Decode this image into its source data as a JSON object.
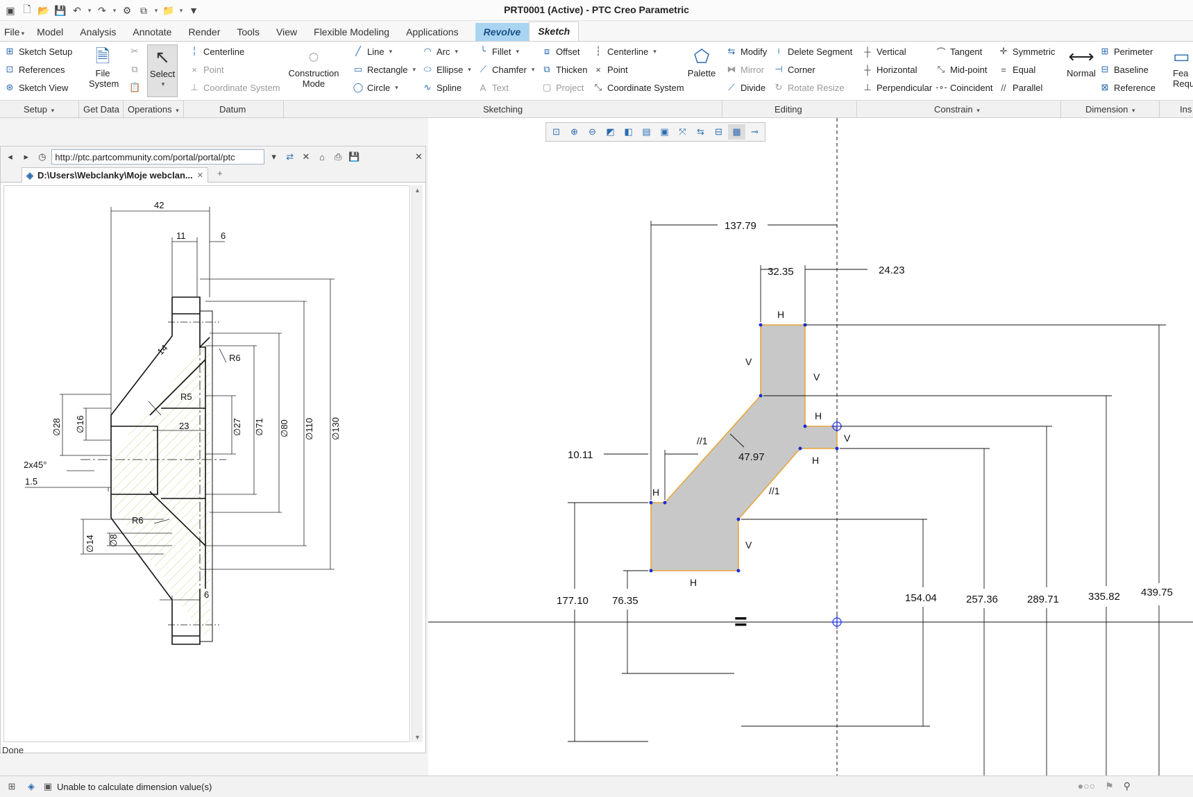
{
  "window": {
    "title": "PRT0001 (Active) - PTC Creo Parametric"
  },
  "quick_access": [
    "new-icon",
    "open-icon",
    "save-icon",
    "undo-icon",
    "redo-icon",
    "regenerate-icon",
    "windows-icon",
    "close-icon",
    "customize-icon"
  ],
  "menu_tabs": {
    "file": "File",
    "model": "Model",
    "analysis": "Analysis",
    "annotate": "Annotate",
    "render": "Render",
    "tools": "Tools",
    "view": "View",
    "flexible": "Flexible Modeling",
    "applications": "Applications",
    "revolve": "Revolve",
    "sketch": "Sketch"
  },
  "ribbon": {
    "setup": {
      "sketch_setup": "Sketch Setup",
      "references": "References",
      "sketch_view": "Sketch View"
    },
    "get_data": {
      "file_system": "File System"
    },
    "operations": {
      "select": "Select"
    },
    "datum": {
      "centerline": "Centerline",
      "point": "Point",
      "coordinate_system": "Coordinate System"
    },
    "construction": {
      "construction_mode": "Construction Mode"
    },
    "sketching": {
      "line": "Line",
      "rectangle": "Rectangle",
      "circle": "Circle",
      "arc": "Arc",
      "ellipse": "Ellipse",
      "spline": "Spline",
      "fillet": "Fillet",
      "chamfer": "Chamfer",
      "text": "Text",
      "offset": "Offset",
      "thicken": "Thicken",
      "project": "Project",
      "centerline": "Centerline",
      "point": "Point",
      "coordinate_system": "Coordinate System",
      "palette": "Palette"
    },
    "editing": {
      "modify": "Modify",
      "delete_segment": "Delete Segment",
      "mirror": "Mirror",
      "corner": "Corner",
      "divide": "Divide",
      "rotate_resize": "Rotate Resize"
    },
    "constrain": {
      "vertical": "Vertical",
      "tangent": "Tangent",
      "symmetric": "Symmetric",
      "horizontal": "Horizontal",
      "midpoint": "Mid-point",
      "equal": "Equal",
      "perpendicular": "Perpendicular",
      "coincident": "Coincident",
      "parallel": "Parallel"
    },
    "dimension": {
      "normal": "Normal",
      "perimeter": "Perimeter",
      "baseline": "Baseline",
      "reference": "Reference"
    },
    "inspect": {
      "feature_requirements": "Fea Requir"
    }
  },
  "groups": {
    "setup": "Setup",
    "get_data": "Get Data",
    "operations": "Operations",
    "datum": "Datum",
    "sketching": "Sketching",
    "editing": "Editing",
    "constrain": "Constrain",
    "dimension": "Dimension",
    "inspect": "Ins"
  },
  "browser": {
    "url": "http://ptc.partcommunity.com/portal/portal/ptc",
    "tab_label": "D:\\Users\\Webclanky\\Moje webclan...",
    "status": "Done"
  },
  "drawing": {
    "dims": {
      "d42": "42",
      "d11": "11",
      "d6a": "6",
      "d6b": "6",
      "r6a": "R6",
      "r5": "R5",
      "r6b": "R6",
      "d14a": "14",
      "d23": "23",
      "chamfer": "2x45°",
      "d15": "1.5",
      "dia28": "∅28",
      "dia16": "∅16",
      "dia27": "∅27",
      "dia71": "∅71",
      "dia80": "∅80",
      "dia110": "∅110",
      "dia130": "∅130",
      "dia14": "∅14",
      "dia8": "∅8"
    }
  },
  "sketch": {
    "dims": {
      "d137": "137.79",
      "d32": "32.35",
      "d24": "24.23",
      "d10": "10.11",
      "d47": "47.97",
      "d177": "177.10",
      "d76": "76.35",
      "d154": "154.04",
      "d257": "257.36",
      "d289": "289.71",
      "d335": "335.82",
      "d439": "439.75"
    },
    "constraints": {
      "h1": "H",
      "v1": "V",
      "v2": "V",
      "h2": "H",
      "v3": "V",
      "h3": "H",
      "h4": "H",
      "v4": "V",
      "h5": "H",
      "p1": "//1",
      "p2": "//1"
    },
    "equal_symbol": "="
  },
  "status_bar": {
    "message": "Unable to calculate dimension value(s)"
  },
  "colors": {
    "accent": "#2a6bb0",
    "revolve_tab": "#a9d5f2",
    "sketch_fill": "#c8c8c8",
    "sketch_edge": "#e8a53a",
    "vertex": "#1a2fd6"
  }
}
